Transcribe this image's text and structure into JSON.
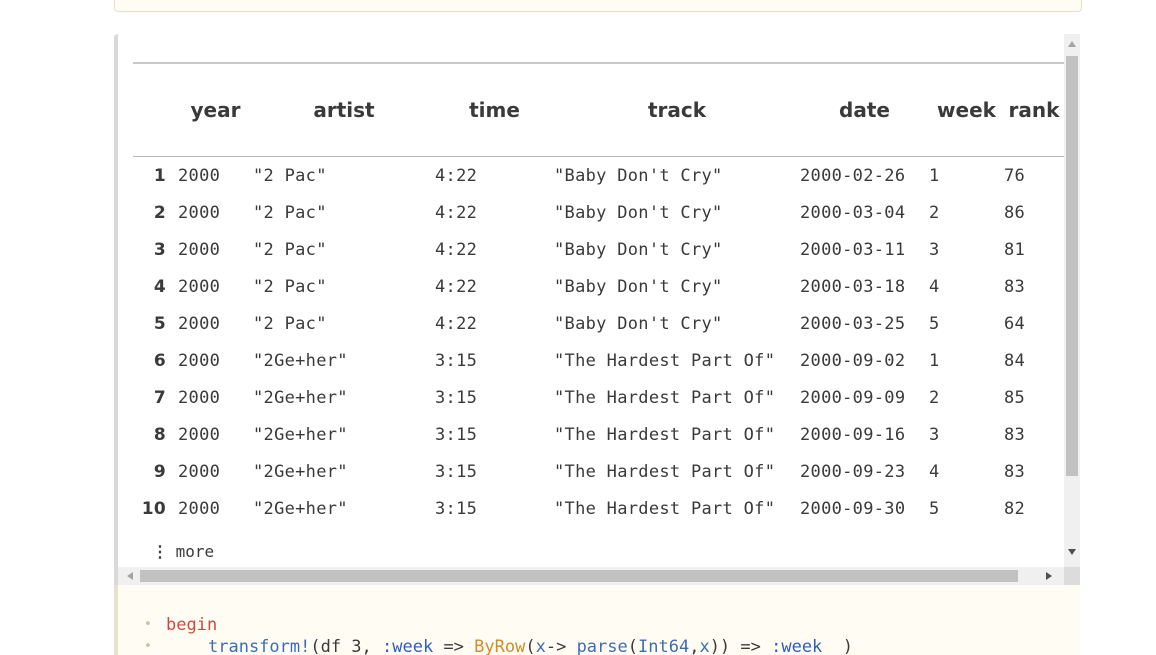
{
  "table": {
    "columns": [
      {
        "label": "",
        "key": "row"
      },
      {
        "label": "year",
        "key": "year"
      },
      {
        "label": "artist",
        "key": "artist"
      },
      {
        "label": "time",
        "key": "time"
      },
      {
        "label": "track",
        "key": "track"
      },
      {
        "label": "date",
        "key": "date"
      },
      {
        "label": "week",
        "key": "week"
      },
      {
        "label": "rank",
        "key": "rank"
      }
    ],
    "rows": [
      {
        "row": "1",
        "year": "2000",
        "artist": "\"2 Pac\"",
        "time": "4:22",
        "track": "\"Baby Don't Cry\"",
        "date": "2000-02-26",
        "week": "1",
        "rank": "76"
      },
      {
        "row": "2",
        "year": "2000",
        "artist": "\"2 Pac\"",
        "time": "4:22",
        "track": "\"Baby Don't Cry\"",
        "date": "2000-03-04",
        "week": "2",
        "rank": "86"
      },
      {
        "row": "3",
        "year": "2000",
        "artist": "\"2 Pac\"",
        "time": "4:22",
        "track": "\"Baby Don't Cry\"",
        "date": "2000-03-11",
        "week": "3",
        "rank": "81"
      },
      {
        "row": "4",
        "year": "2000",
        "artist": "\"2 Pac\"",
        "time": "4:22",
        "track": "\"Baby Don't Cry\"",
        "date": "2000-03-18",
        "week": "4",
        "rank": "83"
      },
      {
        "row": "5",
        "year": "2000",
        "artist": "\"2 Pac\"",
        "time": "4:22",
        "track": "\"Baby Don't Cry\"",
        "date": "2000-03-25",
        "week": "5",
        "rank": "64"
      },
      {
        "row": "6",
        "year": "2000",
        "artist": "\"2Ge+her\"",
        "time": "3:15",
        "track": "\"The Hardest Part Of\"",
        "date": "2000-09-02",
        "week": "1",
        "rank": "84"
      },
      {
        "row": "7",
        "year": "2000",
        "artist": "\"2Ge+her\"",
        "time": "3:15",
        "track": "\"The Hardest Part Of\"",
        "date": "2000-09-09",
        "week": "2",
        "rank": "85"
      },
      {
        "row": "8",
        "year": "2000",
        "artist": "\"2Ge+her\"",
        "time": "3:15",
        "track": "\"The Hardest Part Of\"",
        "date": "2000-09-16",
        "week": "3",
        "rank": "83"
      },
      {
        "row": "9",
        "year": "2000",
        "artist": "\"2Ge+her\"",
        "time": "3:15",
        "track": "\"The Hardest Part Of\"",
        "date": "2000-09-23",
        "week": "4",
        "rank": "83"
      },
      {
        "row": "10",
        "year": "2000",
        "artist": "\"2Ge+her\"",
        "time": "3:15",
        "track": "\"The Hardest Part Of\"",
        "date": "2000-09-30",
        "week": "5",
        "rank": "82"
      }
    ],
    "more_icon": "⋮",
    "more_label": "more"
  },
  "code": {
    "line1": "begin",
    "line2_tokens": [
      {
        "t": "transform!",
        "c": "fn"
      },
      {
        "t": "(df_3, ",
        "c": "plain"
      },
      {
        "t": ":week",
        "c": "sym"
      },
      {
        "t": " => ",
        "c": "plain"
      },
      {
        "t": "ByRow",
        "c": "ctor"
      },
      {
        "t": "(",
        "c": "plain"
      },
      {
        "t": "x",
        "c": "fn"
      },
      {
        "t": "-> ",
        "c": "plain"
      },
      {
        "t": "parse",
        "c": "fn"
      },
      {
        "t": "(",
        "c": "plain"
      },
      {
        "t": "Int64",
        "c": "fn"
      },
      {
        "t": ",",
        "c": "plain"
      },
      {
        "t": "x",
        "c": "fn"
      },
      {
        "t": ")) => ",
        "c": "plain"
      },
      {
        "t": ":week",
        "c": "sym"
      },
      {
        "t": "  )",
        "c": "plain"
      }
    ]
  },
  "colors": {
    "keyword": "#d0483f",
    "function": "#3c6db3",
    "symbol": "#2a5ec0",
    "constructor": "#d28a2a"
  }
}
